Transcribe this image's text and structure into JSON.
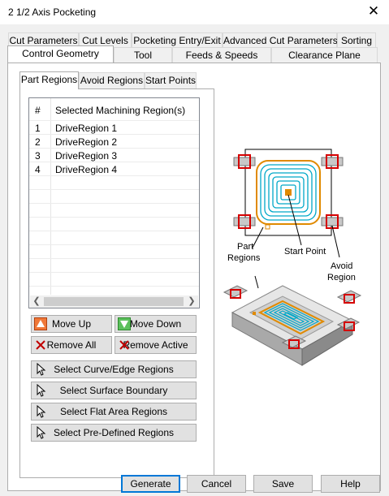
{
  "window": {
    "title": "2 1/2 Axis Pocketing",
    "close_glyph": "✕"
  },
  "tabs_row1": [
    "Cut Parameters",
    "Cut Levels",
    "Pocketing Entry/Exit",
    "Advanced Cut Parameters",
    "Sorting"
  ],
  "tabs_row2": [
    "Control Geometry",
    "Tool",
    "Feeds & Speeds",
    "Clearance Plane"
  ],
  "active_tab": "Control Geometry",
  "sub_tabs": [
    "Part Regions",
    "Avoid Regions",
    "Start Points"
  ],
  "active_sub_tab": "Part Regions",
  "region_list": {
    "columns": [
      "#",
      "Selected Machining Region(s)"
    ],
    "rows": [
      [
        "1",
        "DriveRegion 1"
      ],
      [
        "2",
        "DriveRegion 2"
      ],
      [
        "3",
        "DriveRegion 3"
      ],
      [
        "4",
        "DriveRegion 4"
      ]
    ]
  },
  "buttons": {
    "move_up": "Move Up",
    "move_down": "Move Down",
    "remove_all": "Remove All",
    "remove_active": "Remove Active",
    "select_curve": "Select Curve/Edge Regions",
    "select_surface": "Select Surface Boundary",
    "select_flat": "Select Flat Area Regions",
    "select_predefined": "Select Pre-Defined Regions"
  },
  "figure_labels": {
    "part_regions_line1": "Part",
    "part_regions_line2": "Regions",
    "start_point": "Start Point",
    "avoid_region_line1": "Avoid",
    "avoid_region_line2": "Region"
  },
  "footer": {
    "generate": "Generate",
    "cancel": "Cancel",
    "save": "Save",
    "help": "Help"
  },
  "colors": {
    "toolpath": "#00a8c8",
    "boundary": "#e08a00",
    "avoid": "#d40000",
    "accent": "#0078d7"
  }
}
